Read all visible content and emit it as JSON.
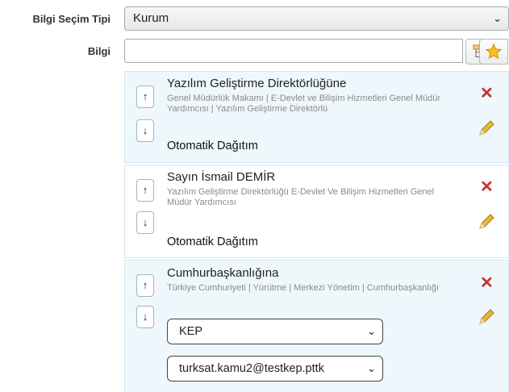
{
  "form": {
    "selection_type_label": "Bilgi Seçim Tipi",
    "selection_type_value": "Kurum",
    "bilgi_label": "Bilgi",
    "bilgi_value": ""
  },
  "icons": {
    "chevron": "⌄",
    "up": "↑",
    "down": "↓",
    "delete": "✕"
  },
  "colors": {
    "card_bg": "#eef7fc",
    "delete_red": "#c9302c",
    "edit_yellow": "#e8b83a",
    "star_yellow": "#f7c219"
  },
  "recipients": [
    {
      "title": "Yazılım Geliştirme Direktörlüğüne",
      "sub": "Genel Müdürlük Makamı | E-Devlet ve Bilişim Hizmetleri Genel Müdür Yardımcısı | Yazılım Geliştirme Direktörlü",
      "distribution": "Otomatik Dağıtım"
    },
    {
      "title": "Sayın İsmail DEMİR",
      "sub": "Yazılım Geliştirme Direktörlüğü E-Devlet Ve Bilişim Hizmetleri Genel Müdür Yardımcısı",
      "distribution": "Otomatik Dağıtım"
    },
    {
      "title": "Cumhurbaşkanlığına",
      "sub": "Türkiye Cumhuriyeti | Yürütme | Merkezi Yönetim | Cumhurbaşkanlığı",
      "channel": "KEP",
      "address": "turksat.kamu2@testkep.pttk"
    }
  ]
}
